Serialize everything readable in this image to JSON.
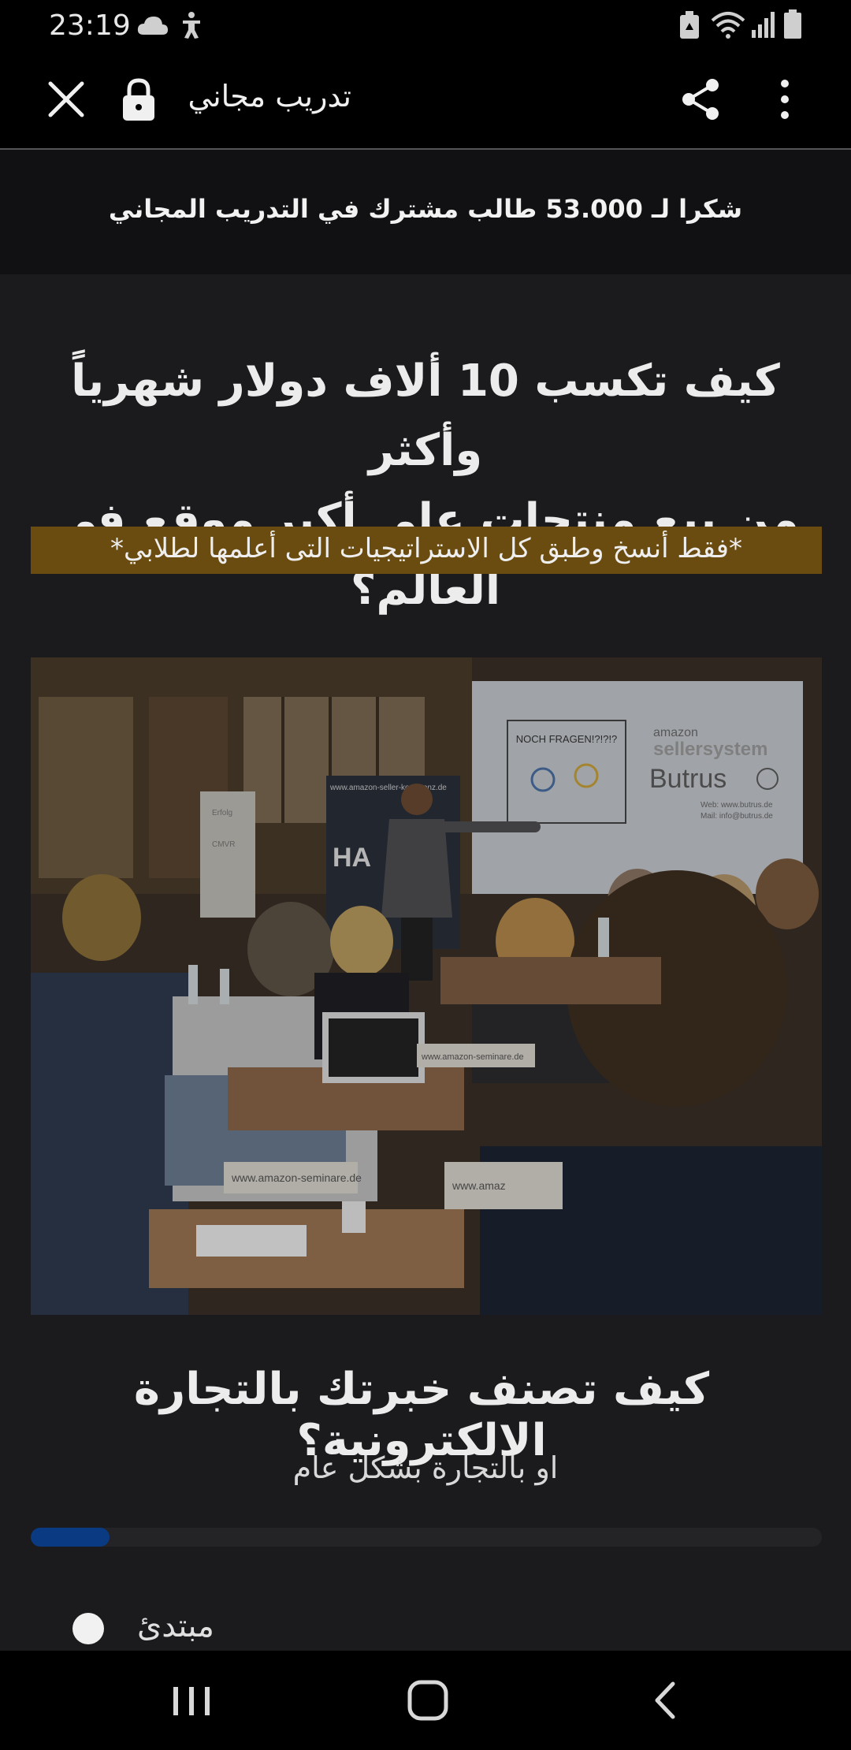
{
  "status_bar": {
    "time": "23:19",
    "left_icons": [
      "cloud-icon",
      "accessibility-icon"
    ],
    "right_icons": [
      "recycle-icon",
      "wifi-icon",
      "signal-icon",
      "battery-icon"
    ]
  },
  "toolbar": {
    "title": "تدريب مجاني",
    "close_icon": "close-icon",
    "lock_icon": "lock-icon",
    "share_icon": "share-icon",
    "menu_icon": "more-vert-icon"
  },
  "thanks_bar": {
    "text": "شكرا لـ 53.000 طالب مشترك في التدريب المجاني"
  },
  "headline": {
    "line1": "كيف تكسب 10 ألاف دولار شهرياً وأكثر",
    "line2": "من بيع منتجات على أكبر موقع في العالم؟"
  },
  "banner": {
    "text": "*فقط أنسخ وطبق كل الاستراتيجيات التى أعلمها لطلابي*",
    "color": "#6a4b10"
  },
  "photo": {
    "screen_brand_top": "amazon",
    "screen_brand_main": "sellersystem",
    "screen_name": "Butrus",
    "screen_web": "Web: www.butrus.de",
    "screen_mail": "Mail: info@butrus.de",
    "screen_note": "NOCH FRAGEN!?!?!?",
    "rollup_url": "www.amazon-seller-konferenz.de",
    "rollup_big": "HA",
    "tent_card_1": "www.amazon-seminare.de",
    "tent_card_2": "www.amazon-seminare.de",
    "tent_card_3": "www.amaz",
    "flipchart_text_1": "Erfolg",
    "flipchart_text_2": "CMVR"
  },
  "question": {
    "title": "كيف تصنف خبرتك بالتجارة الالكترونية؟",
    "subtitle": "او بالتجارة بشكل عام",
    "progress": 0.1,
    "progress_color": "#0a3a82",
    "options": [
      {
        "label": "مبتدئ"
      }
    ]
  },
  "nav_bar": {
    "recents_icon": "recents-icon",
    "home_icon": "home-icon",
    "back_icon": "back-icon"
  }
}
